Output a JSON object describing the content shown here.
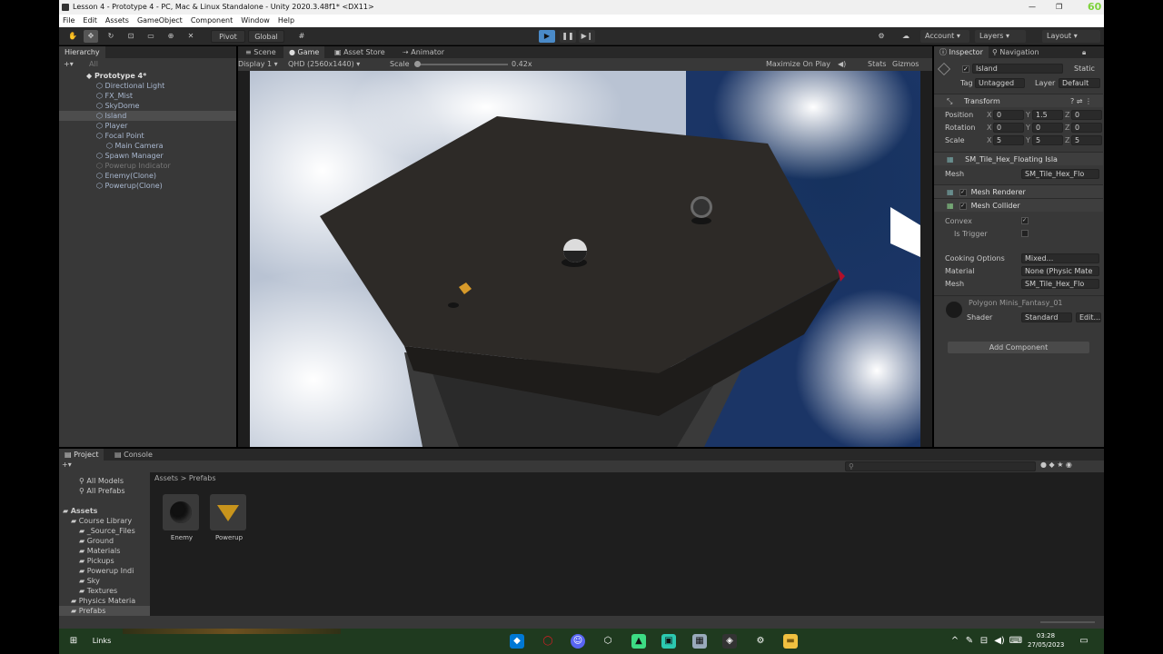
{
  "window": {
    "title": "Lesson 4 - Prototype 4 - PC, Mac & Linux Standalone - Unity 2020.3.48f1* <DX11>",
    "fps_overlay": "60"
  },
  "menu": [
    "File",
    "Edit",
    "Assets",
    "GameObject",
    "Component",
    "Window",
    "Help"
  ],
  "toolbar": {
    "pivot": "Pivot",
    "global": "Global",
    "account": "Account",
    "layers": "Layers",
    "layout": "Layout"
  },
  "hierarchy": {
    "tab": "Hierarchy",
    "search_placeholder": "All",
    "items": [
      {
        "label": "Prototype 4*",
        "indent": 0
      },
      {
        "label": "Directional Light",
        "indent": 1
      },
      {
        "label": "FX_Mist",
        "indent": 1
      },
      {
        "label": "SkyDome",
        "indent": 1
      },
      {
        "label": "Island",
        "indent": 1
      },
      {
        "label": "Player",
        "indent": 1
      },
      {
        "label": "Focal Point",
        "indent": 1
      },
      {
        "label": "Main Camera",
        "indent": 2
      },
      {
        "label": "Spawn Manager",
        "indent": 1
      },
      {
        "label": "Powerup Indicator",
        "indent": 1
      },
      {
        "label": "Enemy(Clone)",
        "indent": 1
      },
      {
        "label": "Powerup(Clone)",
        "indent": 1
      }
    ]
  },
  "game_view": {
    "tabs": [
      "Scene",
      "Game",
      "Asset Store",
      "Animator"
    ],
    "display": "Display 1",
    "resolution": "QHD (2560x1440)",
    "scale_label": "Scale",
    "scale_value": "0.42x",
    "maximize": "Maximize On Play",
    "stats": "Stats",
    "gizmos": "Gizmos"
  },
  "inspector": {
    "tabs": [
      "Inspector",
      "Navigation"
    ],
    "object_name": "Island",
    "static": "Static",
    "tag_label": "Tag",
    "tag_value": "Untagged",
    "layer_label": "Layer",
    "layer_value": "Default",
    "transform": {
      "title": "Transform",
      "rows": [
        {
          "label": "Position",
          "x": "0",
          "y": "1.5",
          "z": "0"
        },
        {
          "label": "Rotation",
          "x": "0",
          "y": "0",
          "z": "0"
        },
        {
          "label": "Scale",
          "x": "5",
          "y": "5",
          "z": "5"
        }
      ]
    },
    "mesh_filter": {
      "title": "SM_Tile_Hex_Floating Isla",
      "mesh_label": "Mesh",
      "mesh_value": "SM_Tile_Hex_Flo"
    },
    "mesh_renderer": "Mesh Renderer",
    "mesh_collider": {
      "title": "Mesh Collider",
      "convex": "Convex",
      "is_trigger": "Is Trigger",
      "cooking": "Cooking Options",
      "cooking_value": "Mixed...",
      "material": "Material",
      "material_value": "None (Physic Mate",
      "mesh": "Mesh",
      "mesh_value": "SM_Tile_Hex_Flo"
    },
    "material": {
      "name": "Polygon Minis_Fantasy_01",
      "shader_label": "Shader",
      "shader_value": "Standard",
      "edit": "Edit..."
    },
    "add_component": "Add Component"
  },
  "project": {
    "tabs": [
      "Project",
      "Console"
    ],
    "breadcrumb": [
      "Assets",
      "Prefabs"
    ],
    "favorites": [
      "All Models",
      "All Prefabs"
    ],
    "tree": [
      {
        "label": "Assets",
        "indent": 0
      },
      {
        "label": "Course Library",
        "indent": 1
      },
      {
        "label": "_Source_Files",
        "indent": 2
      },
      {
        "label": "Ground",
        "indent": 2
      },
      {
        "label": "Materials",
        "indent": 2
      },
      {
        "label": "Pickups",
        "indent": 2
      },
      {
        "label": "Powerup Indi",
        "indent": 2
      },
      {
        "label": "Sky",
        "indent": 2
      },
      {
        "label": "Textures",
        "indent": 2
      },
      {
        "label": "Physics Materia",
        "indent": 1
      },
      {
        "label": "Prefabs",
        "indent": 1
      }
    ],
    "assets": [
      {
        "label": "Enemy",
        "color": "#111111"
      },
      {
        "label": "Powerup",
        "color": "#c8941c"
      }
    ]
  },
  "taskbar": {
    "links": "Links",
    "time": "03:28",
    "date": "27/05/2023"
  }
}
